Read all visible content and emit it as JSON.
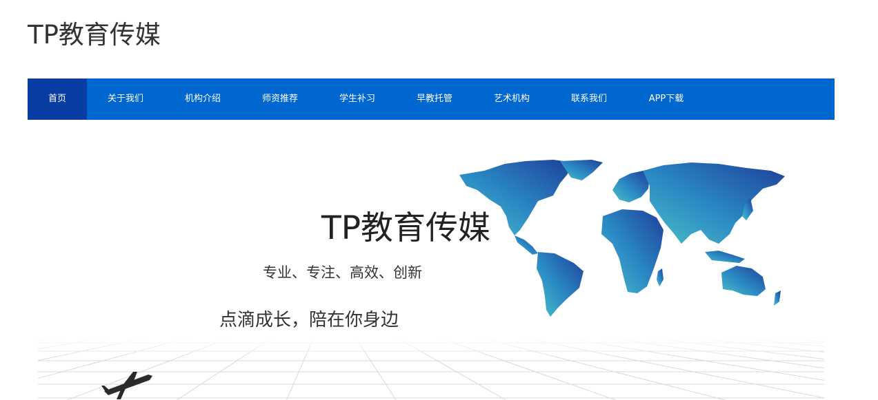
{
  "site": {
    "title": "TP教育传媒"
  },
  "nav": {
    "items": [
      {
        "label": "首页",
        "active": true
      },
      {
        "label": "关于我们",
        "active": false
      },
      {
        "label": "机构介绍",
        "active": false
      },
      {
        "label": "师资推荐",
        "active": false
      },
      {
        "label": "学生补习",
        "active": false
      },
      {
        "label": "早教托管",
        "active": false
      },
      {
        "label": "艺术机构",
        "active": false
      },
      {
        "label": "联系我们",
        "active": false
      },
      {
        "label": "APP下载",
        "active": false
      }
    ]
  },
  "banner": {
    "title": "TP教育传媒",
    "tagline": "专业、专注、高效、创新",
    "slogan": "点滴成长，陪在你身边",
    "images": [
      "world-map-illustration",
      "airplane-illustration",
      "perspective-grid-floor"
    ]
  },
  "colors": {
    "nav_bg": "#0066d0",
    "nav_active": "#0a3da3",
    "map_dark": "#1f4aa0",
    "map_light": "#4dc0c6"
  }
}
